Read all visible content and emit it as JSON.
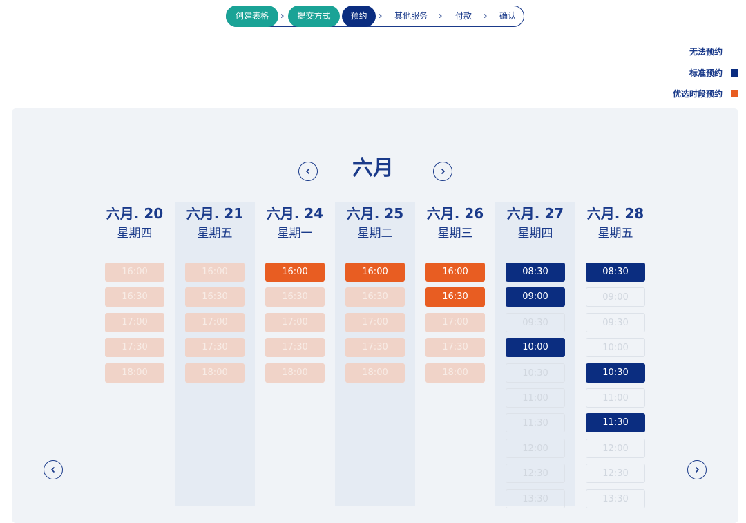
{
  "stepper": {
    "steps": [
      {
        "label": "创建表格",
        "state": "done"
      },
      {
        "label": "提交方式",
        "state": "done"
      },
      {
        "label": "预约",
        "state": "active"
      },
      {
        "label": "其他服务",
        "state": "todo"
      },
      {
        "label": "付款",
        "state": "todo"
      },
      {
        "label": "确认",
        "state": "todo"
      }
    ]
  },
  "legend": {
    "unavailable": "无法预约",
    "standard": "标准预约",
    "preferred": "优选时段预约",
    "colors": {
      "unavailable": "#ffffff",
      "standard": "#0b2d80",
      "preferred": "#e85d22"
    }
  },
  "calendar": {
    "month": "六月",
    "days": [
      {
        "date": "六月. 20",
        "weekday": "星期四",
        "slots": [
          {
            "time": "16:00",
            "status": "unavailable-preferred"
          },
          {
            "time": "16:30",
            "status": "unavailable-preferred"
          },
          {
            "time": "17:00",
            "status": "unavailable-preferred"
          },
          {
            "time": "17:30",
            "status": "unavailable-preferred"
          },
          {
            "time": "18:00",
            "status": "unavailable-preferred"
          }
        ]
      },
      {
        "date": "六月. 21",
        "weekday": "星期五",
        "slots": [
          {
            "time": "16:00",
            "status": "unavailable-preferred"
          },
          {
            "time": "16:30",
            "status": "unavailable-preferred"
          },
          {
            "time": "17:00",
            "status": "unavailable-preferred"
          },
          {
            "time": "17:30",
            "status": "unavailable-preferred"
          },
          {
            "time": "18:00",
            "status": "unavailable-preferred"
          }
        ]
      },
      {
        "date": "六月. 24",
        "weekday": "星期一",
        "slots": [
          {
            "time": "16:00",
            "status": "preferred"
          },
          {
            "time": "16:30",
            "status": "unavailable-preferred"
          },
          {
            "time": "17:00",
            "status": "unavailable-preferred"
          },
          {
            "time": "17:30",
            "status": "unavailable-preferred"
          },
          {
            "time": "18:00",
            "status": "unavailable-preferred"
          }
        ]
      },
      {
        "date": "六月. 25",
        "weekday": "星期二",
        "slots": [
          {
            "time": "16:00",
            "status": "preferred"
          },
          {
            "time": "16:30",
            "status": "unavailable-preferred"
          },
          {
            "time": "17:00",
            "status": "unavailable-preferred"
          },
          {
            "time": "17:30",
            "status": "unavailable-preferred"
          },
          {
            "time": "18:00",
            "status": "unavailable-preferred"
          }
        ]
      },
      {
        "date": "六月. 26",
        "weekday": "星期三",
        "slots": [
          {
            "time": "16:00",
            "status": "preferred"
          },
          {
            "time": "16:30",
            "status": "preferred"
          },
          {
            "time": "17:00",
            "status": "unavailable-preferred"
          },
          {
            "time": "17:30",
            "status": "unavailable-preferred"
          },
          {
            "time": "18:00",
            "status": "unavailable-preferred"
          }
        ]
      },
      {
        "date": "六月. 27",
        "weekday": "星期四",
        "slots": [
          {
            "time": "08:30",
            "status": "standard"
          },
          {
            "time": "09:00",
            "status": "standard"
          },
          {
            "time": "09:30",
            "status": "unavailable"
          },
          {
            "time": "10:00",
            "status": "standard"
          },
          {
            "time": "10:30",
            "status": "unavailable"
          },
          {
            "time": "11:00",
            "status": "unavailable"
          },
          {
            "time": "11:30",
            "status": "unavailable"
          },
          {
            "time": "12:00",
            "status": "unavailable"
          },
          {
            "time": "12:30",
            "status": "unavailable"
          },
          {
            "time": "13:30",
            "status": "unavailable"
          }
        ]
      },
      {
        "date": "六月. 28",
        "weekday": "星期五",
        "slots": [
          {
            "time": "08:30",
            "status": "standard"
          },
          {
            "time": "09:00",
            "status": "unavailable"
          },
          {
            "time": "09:30",
            "status": "unavailable"
          },
          {
            "time": "10:00",
            "status": "unavailable"
          },
          {
            "time": "10:30",
            "status": "standard"
          },
          {
            "time": "11:00",
            "status": "unavailable"
          },
          {
            "time": "11:30",
            "status": "standard"
          },
          {
            "time": "12:00",
            "status": "unavailable"
          },
          {
            "time": "12:30",
            "status": "unavailable"
          },
          {
            "time": "13:30",
            "status": "unavailable"
          }
        ]
      }
    ]
  },
  "icons": {
    "prev_month": "chevron-left-icon",
    "next_month": "chevron-right-icon",
    "prev_week": "chevron-left-icon",
    "next_week": "chevron-right-icon"
  }
}
